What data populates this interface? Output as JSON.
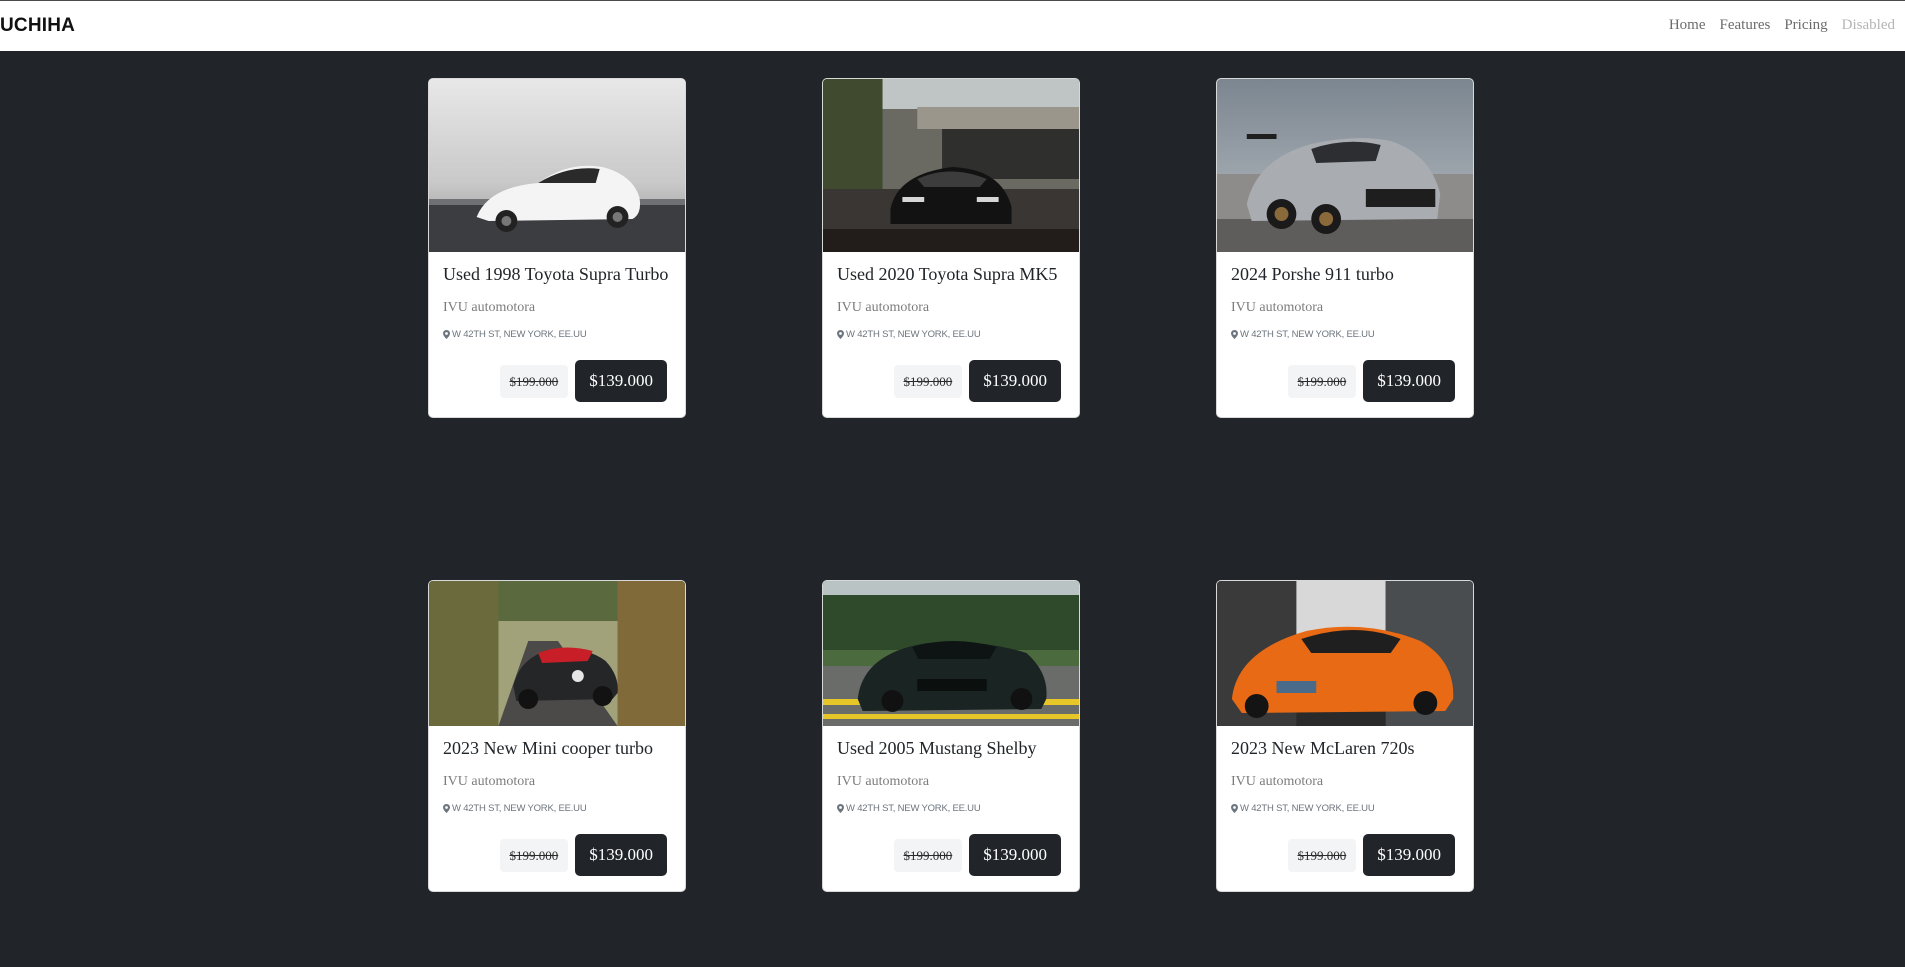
{
  "navbar": {
    "brand": "UCHIHA",
    "links": [
      {
        "label": "Home",
        "disabled": false
      },
      {
        "label": "Features",
        "disabled": false
      },
      {
        "label": "Pricing",
        "disabled": false
      },
      {
        "label": "Disabled",
        "disabled": true
      }
    ]
  },
  "cards": [
    {
      "title": "Used 1998 Toyota Supra Turbo",
      "dealer": "IVU automotora",
      "location": "W 42TH ST, NEW YORK, EE.UU",
      "old_price": "$199.000",
      "price": "$139.000",
      "image": "white-supra-photo"
    },
    {
      "title": "Used 2020 Toyota Supra MK5",
      "dealer": "IVU automotora",
      "location": "W 42TH ST, NEW YORK, EE.UU",
      "old_price": "$199.000",
      "price": "$139.000",
      "image": "black-supra-photo"
    },
    {
      "title": "2024 Porshe 911 turbo",
      "dealer": "IVU automotora",
      "location": "W 42TH ST, NEW YORK, EE.UU",
      "old_price": "$199.000",
      "price": "$139.000",
      "image": "grey-porsche-photo"
    },
    {
      "title": "2023 New Mini cooper turbo",
      "dealer": "IVU automotora",
      "location": "W 42TH ST, NEW YORK, EE.UU",
      "old_price": "$199.000",
      "price": "$139.000",
      "image": "mini-cooper-photo"
    },
    {
      "title": "Used 2005 Mustang Shelby",
      "dealer": "IVU automotora",
      "location": "W 42TH ST, NEW YORK, EE.UU",
      "old_price": "$199.000",
      "price": "$139.000",
      "image": "mustang-photo"
    },
    {
      "title": "2023 New McLaren 720s",
      "dealer": "IVU automotora",
      "location": "W 42TH ST, NEW YORK, EE.UU",
      "old_price": "$199.000",
      "price": "$139.000",
      "image": "orange-mclaren-photo"
    }
  ],
  "colors": {
    "page_background": "#212529",
    "navbar_background": "#ffffff",
    "price_button": "#212529",
    "old_price_background": "#f3f4f5"
  }
}
